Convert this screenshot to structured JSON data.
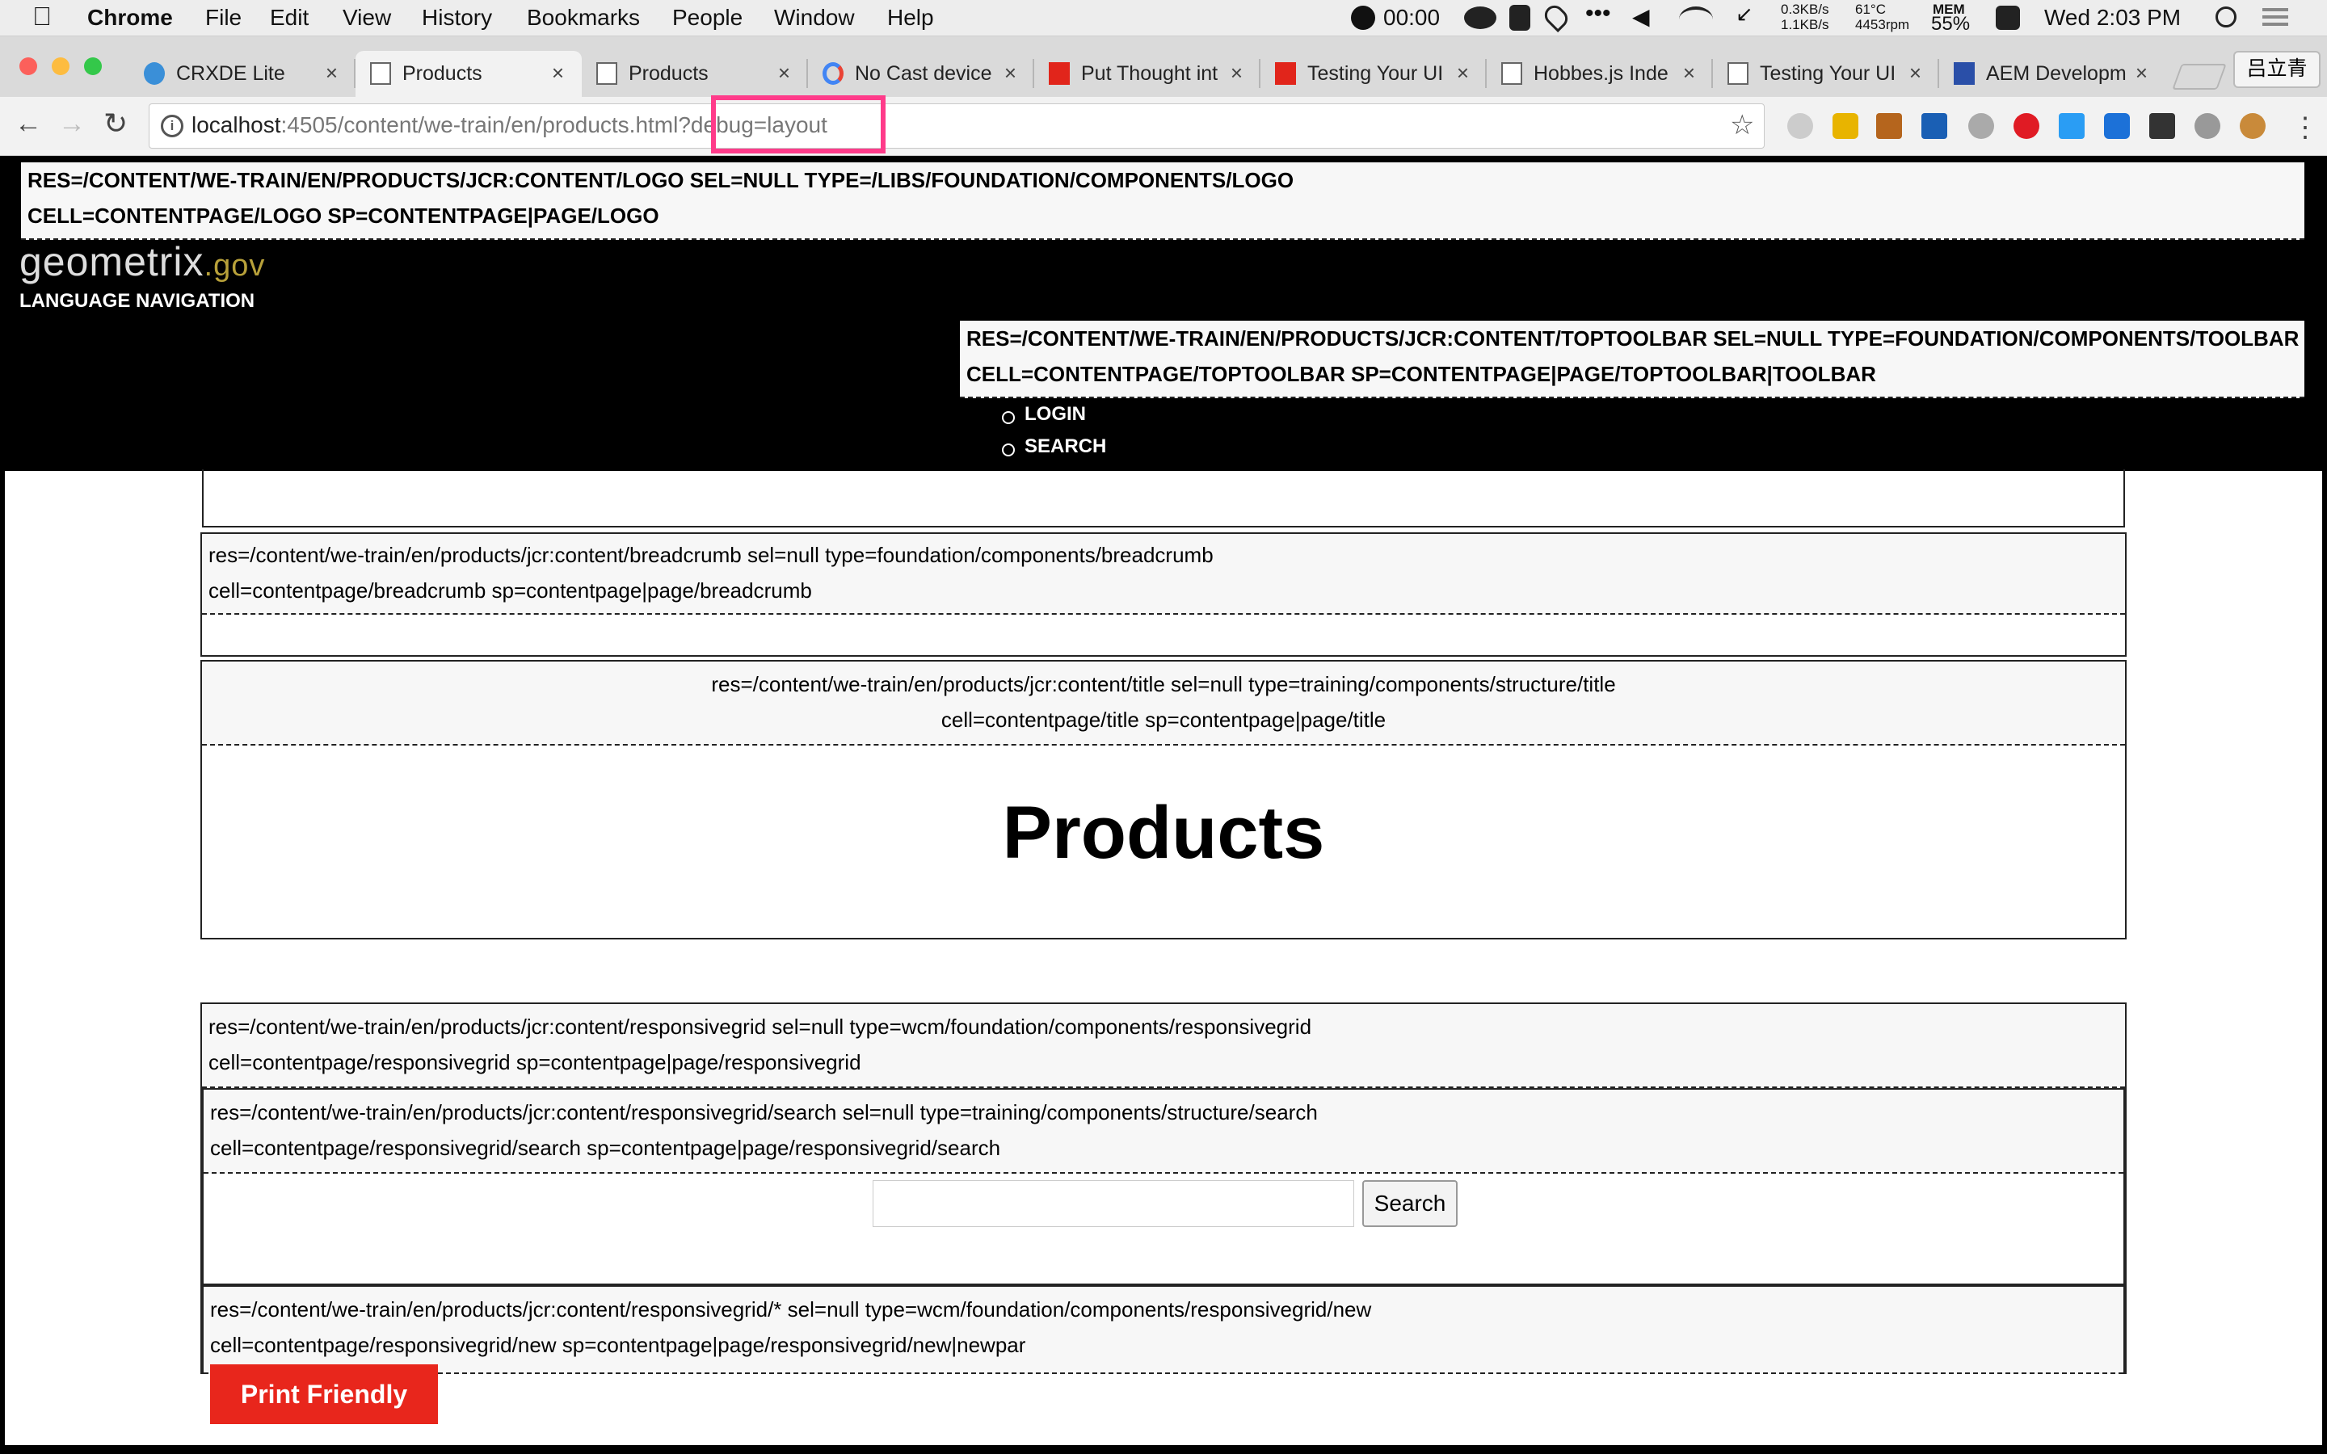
{
  "menubar": {
    "app": "Chrome",
    "menus": [
      "File",
      "Edit",
      "View",
      "History",
      "Bookmarks",
      "People",
      "Window",
      "Help"
    ],
    "timer": "00:00",
    "net_up": "0.3KB/s",
    "net_down": "1.1KB/s",
    "temp": "61°C",
    "rpm": "4453rpm",
    "mem_label": "MEM",
    "mem_value": "55%",
    "clock": "Wed 2:03 PM"
  },
  "tabs": [
    {
      "label": "CRXDE Lite"
    },
    {
      "label": "Products"
    },
    {
      "label": "Products"
    },
    {
      "label": "No Cast device"
    },
    {
      "label": "Put Thought int"
    },
    {
      "label": "Testing Your UI"
    },
    {
      "label": "Hobbes.js Inde"
    },
    {
      "label": "Testing Your UI"
    },
    {
      "label": "AEM Developm"
    }
  ],
  "profile_name": "吕立青",
  "address": {
    "host": "localhost",
    "path": ":4505/content/we-train/en/products.html",
    "query": "?debug=layout"
  },
  "page": {
    "logo_debug": {
      "line1": "res=/content/we-train/en/products/jcr:content/logo sel=null type=/libs/foundation/components/logo",
      "line2": "cell=contentpage/logo sp=contentpage|page/logo"
    },
    "logo_main": "geometrix",
    "logo_suffix": ".gov",
    "language_navigation": "LANGUAGE NAVIGATION",
    "toptoolbar_debug": {
      "line1": "res=/content/we-train/en/products/jcr:content/toptoolbar sel=null type=foundation/components/toolbar",
      "line2": "cell=contentpage/toptoolbar sp=contentpage|page/toptoolbar|toolbar"
    },
    "toolbar_items": [
      "LOGIN",
      "SEARCH"
    ],
    "breadcrumb_debug": {
      "line1": "res=/content/we-train/en/products/jcr:content/breadcrumb sel=null type=foundation/components/breadcrumb",
      "line2": "cell=contentpage/breadcrumb sp=contentpage|page/breadcrumb"
    },
    "title_debug": {
      "line1": "res=/content/we-train/en/products/jcr:content/title sel=null type=training/components/structure/title",
      "line2": "cell=contentpage/title sp=contentpage|page/title"
    },
    "title": "Products",
    "grid_debug": {
      "line1": "res=/content/we-train/en/products/jcr:content/responsivegrid sel=null type=wcm/foundation/components/responsivegrid",
      "line2": "cell=contentpage/responsivegrid sp=contentpage|page/responsivegrid"
    },
    "search_debug": {
      "line1": "res=/content/we-train/en/products/jcr:content/responsivegrid/search sel=null type=training/components/structure/search",
      "line2": "cell=contentpage/responsivegrid/search sp=contentpage|page/responsivegrid/search"
    },
    "search_input_value": "",
    "search_button": "Search",
    "new_debug": {
      "line1": "res=/content/we-train/en/products/jcr:content/responsivegrid/* sel=null type=wcm/foundation/components/responsivegrid/new",
      "line2": "cell=contentpage/responsivegrid/new sp=contentpage|page/responsivegrid/new|newpar"
    },
    "print_button": "Print Friendly"
  },
  "colors": {
    "highlight": "#ff3b8a",
    "header_bg": "#000000",
    "print_btn": "#e8261c"
  }
}
